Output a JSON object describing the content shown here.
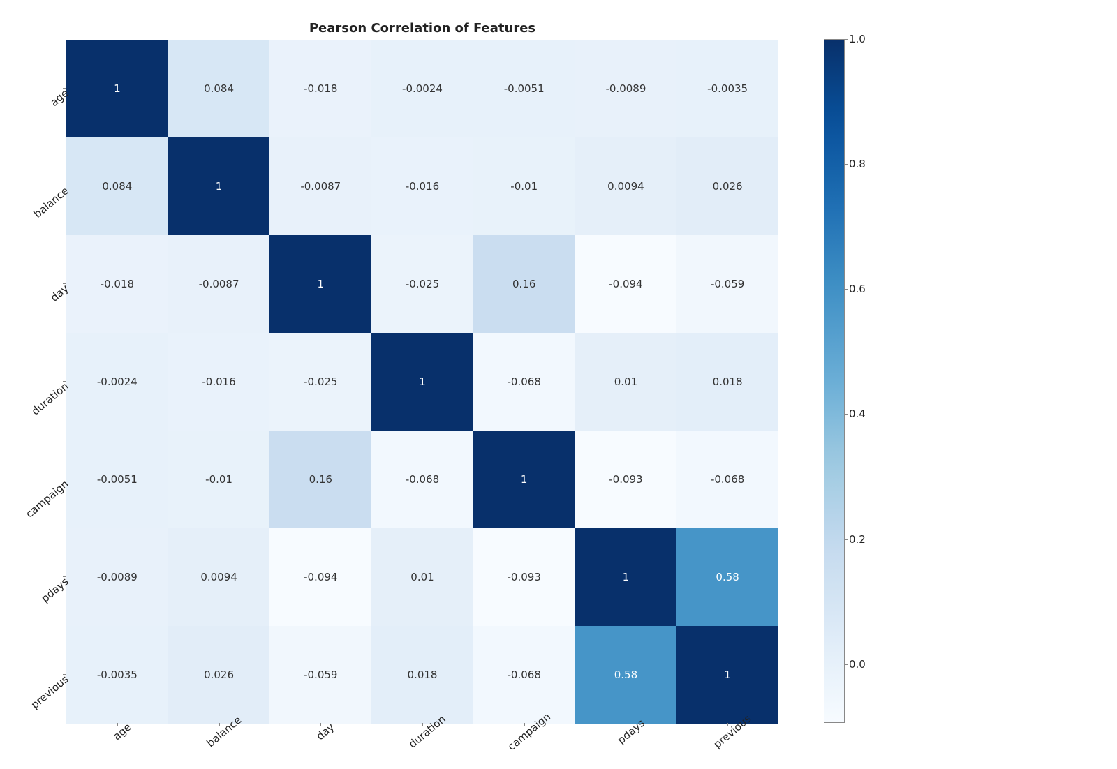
{
  "chart_data": {
    "type": "heatmap",
    "title": "Pearson Correlation of Features",
    "labels": [
      "age",
      "balance",
      "day",
      "duration",
      "campaign",
      "pdays",
      "previous"
    ],
    "matrix": [
      [
        1,
        0.084,
        -0.018,
        -0.0024,
        -0.0051,
        -0.0089,
        -0.0035
      ],
      [
        0.084,
        1,
        -0.0087,
        -0.016,
        -0.01,
        0.0094,
        0.026
      ],
      [
        -0.018,
        -0.0087,
        1,
        -0.025,
        0.16,
        -0.094,
        -0.059
      ],
      [
        -0.0024,
        -0.016,
        -0.025,
        1,
        -0.068,
        0.01,
        0.018
      ],
      [
        -0.0051,
        -0.01,
        0.16,
        -0.068,
        1,
        -0.093,
        -0.068
      ],
      [
        -0.0089,
        0.0094,
        -0.094,
        0.01,
        -0.093,
        1,
        0.58
      ],
      [
        -0.0035,
        0.026,
        -0.059,
        0.018,
        -0.068,
        0.58,
        1
      ]
    ],
    "display": [
      [
        "1",
        "0.084",
        "-0.018",
        "-0.0024",
        "-0.0051",
        "-0.0089",
        "-0.0035"
      ],
      [
        "0.084",
        "1",
        "-0.0087",
        "-0.016",
        "-0.01",
        "0.0094",
        "0.026"
      ],
      [
        "-0.018",
        "-0.0087",
        "1",
        "-0.025",
        "0.16",
        "-0.094",
        "-0.059"
      ],
      [
        "-0.0024",
        "-0.016",
        "-0.025",
        "1",
        "-0.068",
        "0.01",
        "0.018"
      ],
      [
        "-0.0051",
        "-0.01",
        "0.16",
        "-0.068",
        "1",
        "-0.093",
        "-0.068"
      ],
      [
        "-0.0089",
        "0.0094",
        "-0.094",
        "0.01",
        "-0.093",
        "1",
        "0.58"
      ],
      [
        "-0.0035",
        "0.026",
        "-0.059",
        "0.018",
        "-0.068",
        "0.58",
        "1"
      ]
    ],
    "vmin": -0.094,
    "vmax": 1.0,
    "colorbar_ticks": [
      0.0,
      0.2,
      0.4,
      0.6,
      0.8,
      1.0
    ],
    "colorbar_tick_labels": [
      "0.0",
      "0.2",
      "0.4",
      "0.6",
      "0.8",
      "1.0"
    ],
    "colormap": "Blues"
  }
}
